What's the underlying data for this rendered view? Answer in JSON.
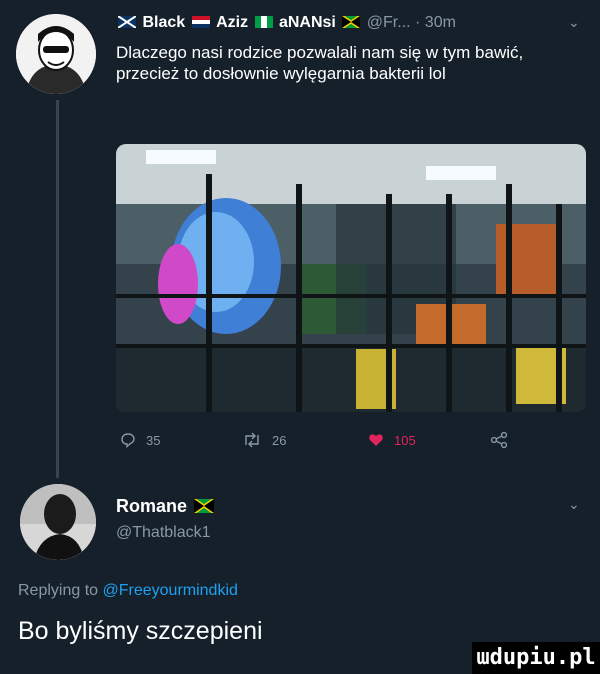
{
  "tweet": {
    "author_name_1": "Black",
    "author_name_2": "Aziz",
    "author_name_3": "aNANsi",
    "handle": "@Fr...",
    "time": "· 30m",
    "text": "Dlaczego nasi rodzice pozwalali nam się w tym bawić, przecież to dosłownie wylęgarnia bakterii lol",
    "stats": {
      "replies": "35",
      "retweets": "26",
      "likes": "105"
    }
  },
  "reply": {
    "author_name": "Romane",
    "handle": "@Thatblack1",
    "replying_prefix": "Replying to",
    "replying_handle": "@Freeyourmindkid",
    "text": "Bo byliśmy szczepieni"
  },
  "watermark": "ɯdupiu.pl",
  "colors": {
    "background": "#15202b",
    "muted": "#8899a6",
    "link": "#1da1f2",
    "like": "#e0245e"
  }
}
